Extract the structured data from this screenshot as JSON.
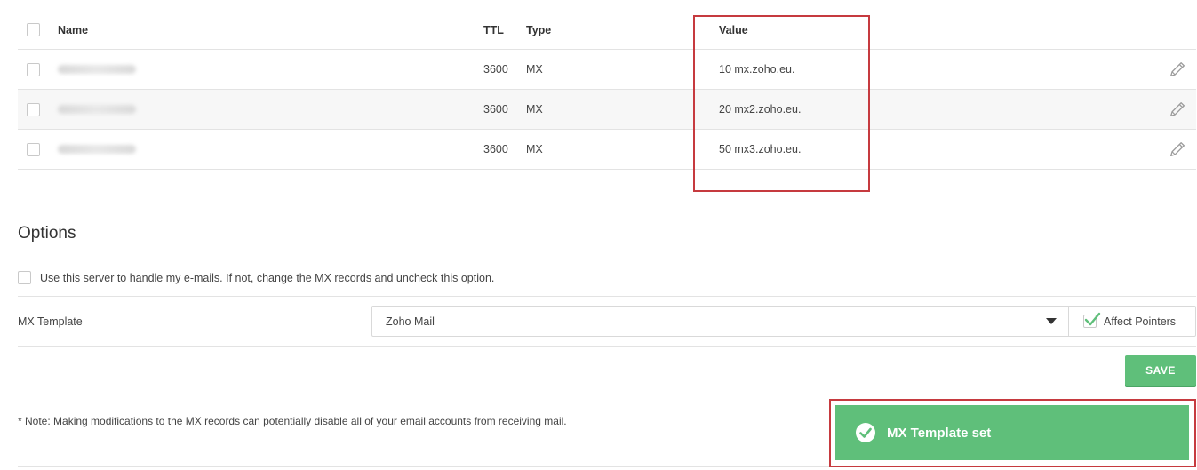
{
  "table": {
    "headers": {
      "name": "Name",
      "ttl": "TTL",
      "type": "Type",
      "value": "Value"
    },
    "rows": [
      {
        "ttl": "3600",
        "type": "MX",
        "value": "10 mx.zoho.eu."
      },
      {
        "ttl": "3600",
        "type": "MX",
        "value": "20 mx2.zoho.eu."
      },
      {
        "ttl": "3600",
        "type": "MX",
        "value": "50 mx3.zoho.eu."
      }
    ]
  },
  "options": {
    "title": "Options",
    "use_server_label": "Use this server to handle my e-mails. If not, change the MX records and uncheck this option.",
    "use_server_checked": false,
    "mx_template_label": "MX Template",
    "mx_template_value": "Zoho Mail",
    "affect_pointers_label": "Affect Pointers",
    "affect_pointers_checked": true,
    "save_label": "SAVE"
  },
  "note": "* Note: Making modifications to the MX records can potentially disable all of your email accounts from receiving mail.",
  "toast": {
    "message": "MX Template set"
  },
  "colors": {
    "accent_green": "#5fbf7a",
    "highlight_red": "#c63a3f",
    "border_gray": "#e3e3e3"
  },
  "icons": {
    "edit": "pencil-icon",
    "dropdown": "chevron-down-icon",
    "success": "check-circle-icon"
  }
}
